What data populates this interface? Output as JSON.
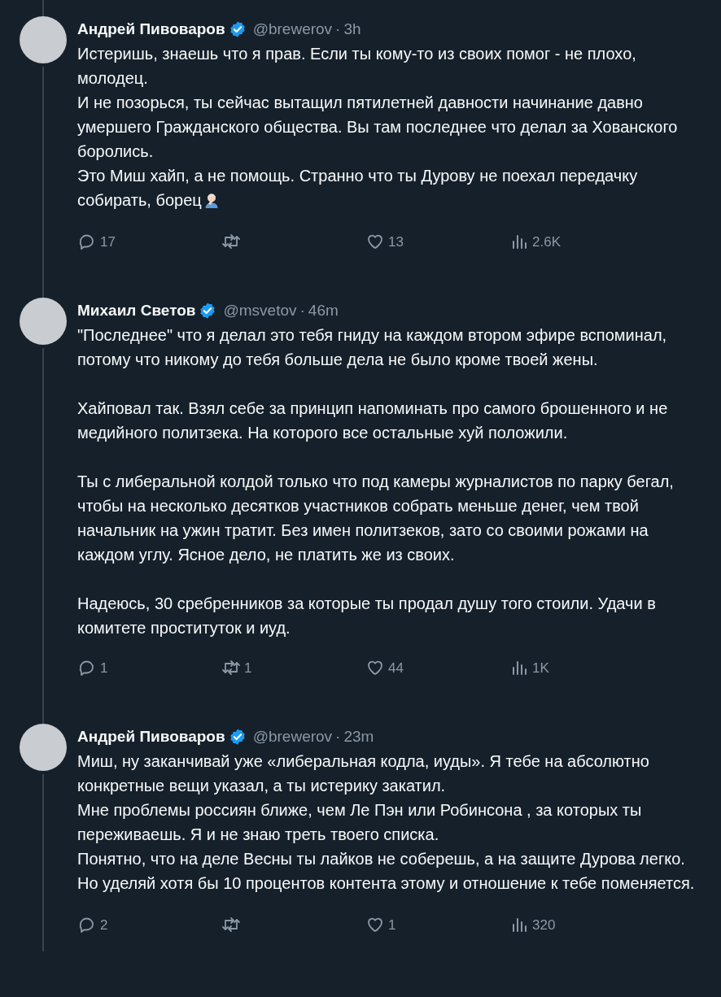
{
  "tweets": [
    {
      "author": "Андрей Пивоваров",
      "verified": true,
      "handle": "@brewerov",
      "separator": "·",
      "time": "3h",
      "text": "Истеришь, знаешь что я прав. Если ты кому-то из своих помог - не плохо, молодец.\nИ не позорься, ты сейчас вытащил пятилетней давности начинание давно умершего Гражданского общества. Вы там последнее что делал за Хованского боролись.\nЭто Миш хайп, а не помощь. Странно что ты Дурову не поехал передачку собирать, борец",
      "emoji": {
        "kind": "facepalm"
      },
      "stats": [
        {
          "kind": "reply",
          "count": "17"
        },
        {
          "kind": "retweet"
        },
        {
          "kind": "like",
          "count": "13"
        },
        {
          "kind": "views",
          "count": "2.6K"
        }
      ]
    },
    {
      "author": "Михаил Светов",
      "verified": true,
      "handle": "@msvetov",
      "separator": "·",
      "time": "46m",
      "text": "\"Последнее\" что я делал это тебя гниду на каждом втором эфире вспоминал, потому что никому до тебя больше дела не было кроме твоей жены.\n\nХайповал так. Взял себе за принцип напоминать про самого брошенного и не медийного политзека. На которого все остальные хуй положили.\n\nТы с либеральной колдой только что под камеры журналистов по парку бегал, чтобы на несколько десятков участников собрать меньше денег, чем твой начальник на ужин тратит. Без имен политзеков, зато со своими рожами на каждом углу. Ясное дело, не платить же из своих.\n\nНадеюсь, 30 сребренников за которые ты продал душу того стоили. Удачи в комитете проституток и иуд.",
      "stats": [
        {
          "kind": "reply",
          "count": "1"
        },
        {
          "kind": "retweet",
          "count": "1"
        },
        {
          "kind": "like",
          "count": "44"
        },
        {
          "kind": "views",
          "count": "1K"
        }
      ]
    },
    {
      "author": "Андрей Пивоваров",
      "verified": true,
      "handle": "@brewerov",
      "separator": "·",
      "time": "23m",
      "text": "Миш, ну заканчивай уже «либеральная кодла, иуды».  Я тебе на абсолютно конкретные вещи указал, а ты истерику закатил.\nМне проблемы россиян ближе, чем Ле Пэн или Робинсона , за которых ты переживаешь. Я и не знаю треть твоего списка.\nПонятно, что на деле Весны ты лайков не соберешь, а на защите Дурова легко. Но уделяй хотя бы 10 процентов контента этому и отношение к тебе поменяется.",
      "stats": [
        {
          "kind": "reply",
          "count": "2"
        },
        {
          "kind": "retweet"
        },
        {
          "kind": "like",
          "count": "1"
        },
        {
          "kind": "views",
          "count": "320"
        }
      ]
    }
  ]
}
